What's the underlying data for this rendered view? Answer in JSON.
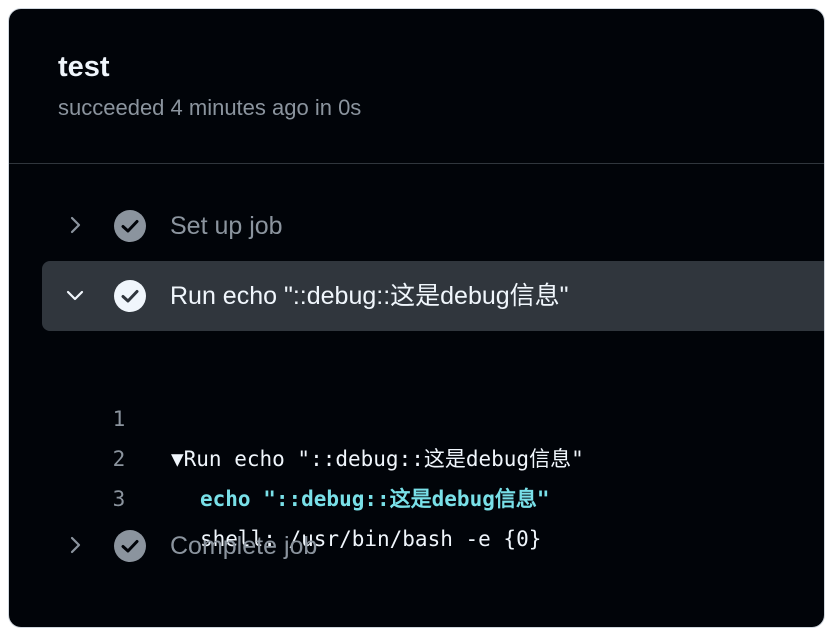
{
  "job": {
    "title": "test",
    "status": "succeeded 4 minutes ago in 0s"
  },
  "steps": [
    {
      "label": "Set up job",
      "expanded": false,
      "status": "success"
    },
    {
      "label": "Run echo \"::debug::这是debug信息\"",
      "expanded": true,
      "status": "success"
    },
    {
      "label": "Complete job",
      "expanded": false,
      "status": "success"
    }
  ],
  "log": {
    "lines": [
      {
        "number": "1",
        "text": "▼Run echo \"::debug::这是debug信息\""
      },
      {
        "number": "2",
        "text": "echo \"::debug::这是debug信息\""
      },
      {
        "number": "3",
        "text": "shell: /usr/bin/bash -e {0}"
      }
    ]
  },
  "colors": {
    "background": "#010409",
    "expanded_step_bg": "#30363d",
    "command_highlight": "#79e0e8",
    "muted_text": "#8b949e",
    "primary_text": "#f0f6fc"
  },
  "icons": {
    "collapsed": "chevron-right-icon",
    "expanded": "chevron-down-icon",
    "success": "check-circle-icon"
  }
}
